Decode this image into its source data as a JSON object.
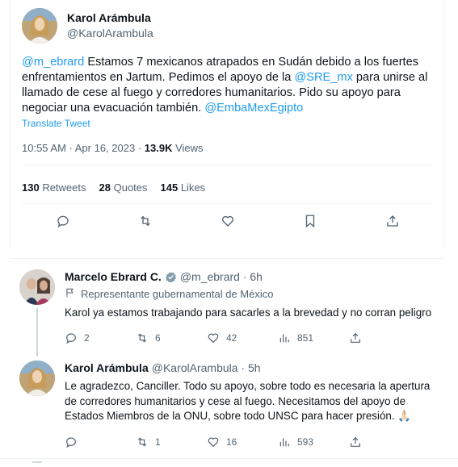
{
  "main": {
    "display_name": "Karol Arámbula",
    "handle": "@KarolArambula",
    "text_parts": {
      "m1": "@m_ebrard",
      "t1": " Estamos 7 mexicanos atrapados en Sudán debido a los fuertes enfrentamientos en Jartum. Pedimos el apoyo de la ",
      "m2": "@SRE_mx",
      "t2": " para unirse al llamado de cese al fuego y corredores humanitarios. Pido su apoyo para negociar una evacuación también. ",
      "m3": "@EmbaMexEgipto"
    },
    "translate": "Translate Tweet",
    "time": "10:55 AM · Apr 16, 2023 · ",
    "views_count": "13.9K",
    "views_label": " Views",
    "stats": {
      "retweets_count": "130",
      "retweets_label": " Retweets",
      "quotes_count": "28",
      "quotes_label": " Quotes",
      "likes_count": "145",
      "likes_label": " Likes"
    },
    "action_icons": [
      "reply-icon",
      "retweet-icon",
      "like-icon",
      "bookmark-icon",
      "share-icon"
    ]
  },
  "replies": [
    {
      "name": "Marcelo Ebrard C.",
      "handle_time": "@m_ebrard · 6h",
      "label": "Representante gubernamental de México",
      "text": "Karol ya estamos trabajando para sacarles a la brevedad y no corran peligro",
      "replies": "2",
      "retweets": "6",
      "likes": "42",
      "views": "851"
    },
    {
      "name": "Karol Arámbula",
      "handle_time": "@KarolArambula · 5h",
      "text": "Le agradezco, Canciller. Todo su apoyo, sobre todo es necesaria la apertura de corredores humanitarios y cese al fuego. Necesitamos del apoyo de Estados Miembros de la ONU, sobre todo UNSC para hacer presión. 🙏🏻",
      "replies": "",
      "retweets": "1",
      "likes": "16",
      "views": "593"
    }
  ],
  "colors": {
    "link": "#1d9bf0",
    "muted": "#536471",
    "verified_gray": "#829aab"
  }
}
